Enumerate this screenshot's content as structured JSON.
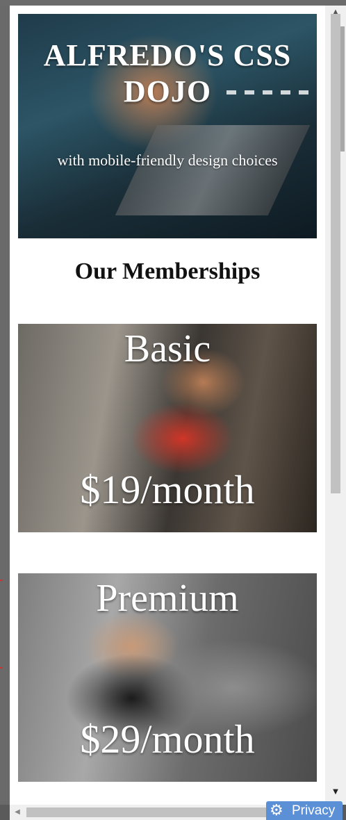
{
  "hero": {
    "title": "ALFREDO'S CSS DOJO",
    "subtitle": "with mobile-friendly design choices"
  },
  "memberships": {
    "heading": "Our Memberships",
    "plans": [
      {
        "name": "Basic",
        "price": "$19/month"
      },
      {
        "name": "Premium",
        "price": "$29/month"
      }
    ]
  },
  "scrollbars": {
    "up_icon": "triangle-up",
    "down_icon": "triangle-down",
    "left_icon": "triangle-left"
  },
  "privacy_badge": {
    "label": "Privacy",
    "icon": "gear-icon",
    "color": "#5b8fd6"
  }
}
